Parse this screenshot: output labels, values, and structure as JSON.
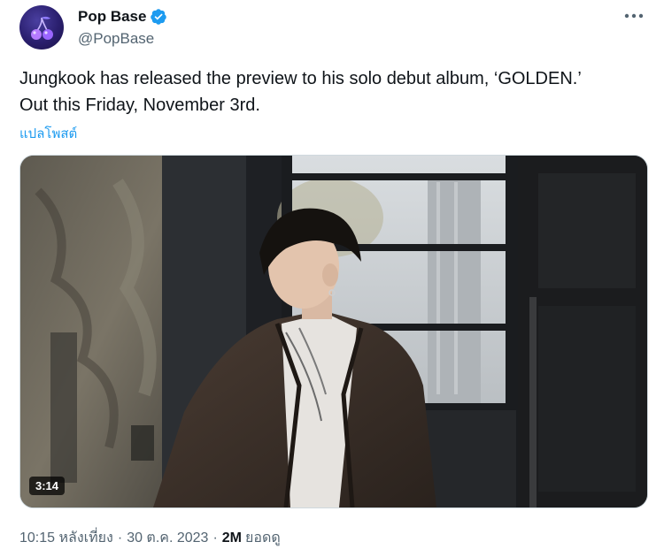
{
  "author": {
    "display_name": "Pop Base",
    "handle": "@PopBase",
    "verified": true,
    "avatar_icon": "cherry-icon"
  },
  "tweet": {
    "text": "Jungkook has released the preview to his solo debut album, ‘GOLDEN.’\nOut this Friday, November 3rd.",
    "translate_label": "แปลโพสต์"
  },
  "media": {
    "type": "video",
    "duration": "3:14"
  },
  "meta": {
    "time": "10:15 หลังเที่ยง",
    "separator1": "·",
    "date": "30 ต.ค. 2023",
    "separator2": "·",
    "views_count": "2M",
    "views_label": "ยอดดู"
  },
  "colors": {
    "accent": "#1d9bf0",
    "secondary_text": "#536471",
    "primary_text": "#0f1419"
  }
}
